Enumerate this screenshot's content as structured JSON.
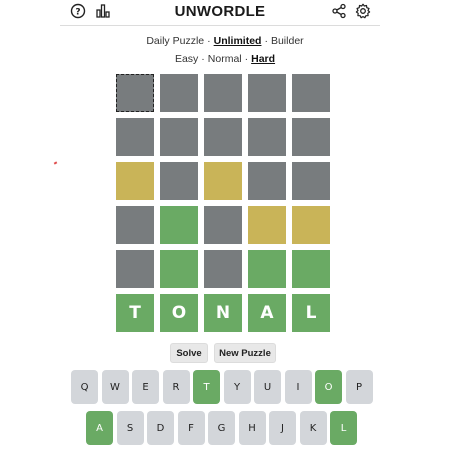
{
  "header": {
    "title": "UNWORDLE",
    "icons": [
      "help-icon",
      "stats-icon",
      "share-icon",
      "settings-icon"
    ]
  },
  "modes_row1": {
    "items": [
      "Daily Puzzle",
      "Unlimited",
      "Builder"
    ],
    "selected": "Unlimited"
  },
  "modes_row2": {
    "items": [
      "Easy",
      "Normal",
      "Hard"
    ],
    "selected": "Hard"
  },
  "colors": {
    "gray": "#787c7e",
    "yellow": "#c9b458",
    "green": "#6aaa64",
    "key": "#d3d6da"
  },
  "board": {
    "rows": [
      [
        "gray",
        "gray",
        "gray",
        "gray",
        "gray"
      ],
      [
        "gray",
        "gray",
        "gray",
        "gray",
        "gray"
      ],
      [
        "yellow",
        "gray",
        "yellow",
        "gray",
        "gray"
      ],
      [
        "gray",
        "green",
        "gray",
        "yellow",
        "yellow"
      ],
      [
        "gray",
        "green",
        "gray",
        "green",
        "green"
      ],
      [
        "green",
        "green",
        "green",
        "green",
        "green"
      ]
    ],
    "answer": [
      "T",
      "O",
      "N",
      "A",
      "L"
    ]
  },
  "buttons": {
    "solve": "Solve",
    "new_puzzle": "New Puzzle"
  },
  "keyboard": {
    "row1": [
      "Q",
      "W",
      "E",
      "R",
      "T",
      "Y",
      "U",
      "I",
      "O",
      "P"
    ],
    "row2": [
      "A",
      "S",
      "D",
      "F",
      "G",
      "H",
      "J",
      "K",
      "L"
    ],
    "green_keys": [
      "T",
      "O",
      "A",
      "L"
    ]
  }
}
